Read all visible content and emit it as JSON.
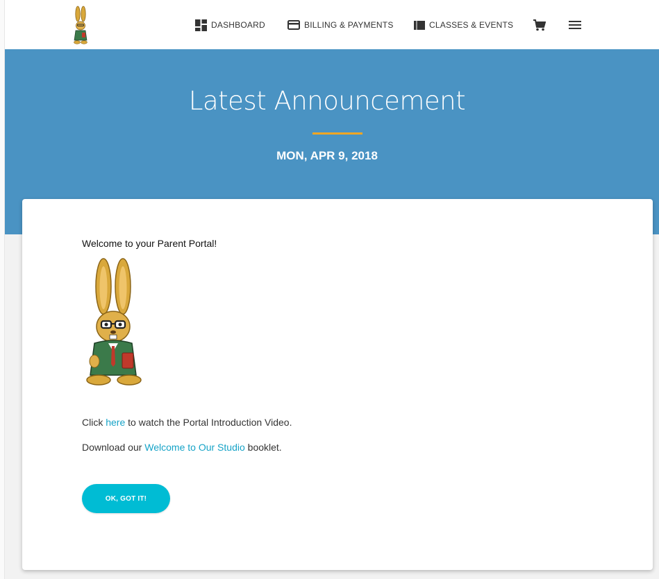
{
  "nav": {
    "items": [
      {
        "label": "DASHBOARD",
        "icon": "dashboard-icon"
      },
      {
        "label": "BILLING & PAYMENTS",
        "icon": "credit-card-icon"
      },
      {
        "label": "CLASSES & EVENTS",
        "icon": "book-icon"
      }
    ],
    "cart_icon": "cart-icon",
    "menu_icon": "hamburger-menu-icon"
  },
  "hero": {
    "title": "Latest Announcement",
    "date": "MON, APR 9, 2018"
  },
  "announcement": {
    "welcome": "Welcome to your Parent Portal!",
    "line1": {
      "before": "Click ",
      "link": "here",
      "after": " to watch the Portal Introduction Video."
    },
    "line2": {
      "before": "Download our ",
      "link": "Welcome to Our Studio",
      "after": " booklet."
    },
    "button_label": "OK, GOT IT!"
  },
  "colors": {
    "hero_bg": "#4a93c3",
    "accent_rule": "#f5a623",
    "link": "#16a3c7",
    "button_bg": "#00bcd4"
  }
}
